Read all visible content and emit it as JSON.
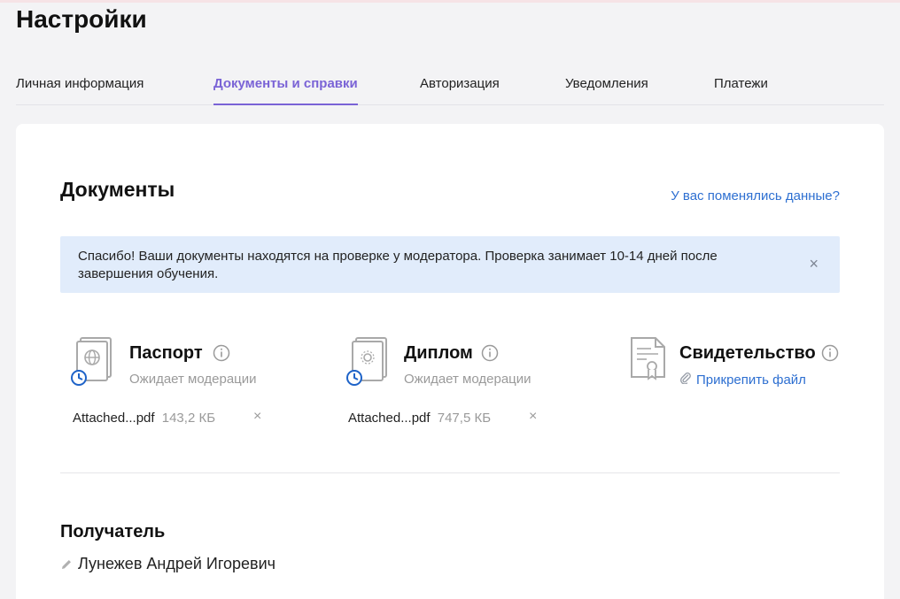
{
  "page": {
    "title": "Настройки"
  },
  "tabs": [
    {
      "label": "Личная информация",
      "active": false
    },
    {
      "label": "Документы и справки",
      "active": true
    },
    {
      "label": "Авторизация",
      "active": false
    },
    {
      "label": "Уведомления",
      "active": false
    },
    {
      "label": "Платежи",
      "active": false
    }
  ],
  "documents": {
    "title": "Документы",
    "data_changed_link": "У вас поменялись данные?",
    "notice": "Спасибо! Ваши документы находятся на проверке у модератора. Проверка занимает 10-14 дней после завершения обучения.",
    "notice_close": "×",
    "items": [
      {
        "title": "Паспорт",
        "status": "Ожидает модерации",
        "file_name": "Attached...pdf",
        "file_size": "143,2 КБ",
        "remove": "×",
        "icon": "passport-icon"
      },
      {
        "title": "Диплом",
        "status": "Ожидает модерации",
        "file_name": "Attached...pdf",
        "file_size": "747,5 КБ",
        "remove": "×",
        "icon": "diploma-icon"
      },
      {
        "title": "Свидетельство",
        "attach_link": "Прикрепить файл",
        "icon": "certificate-icon"
      }
    ]
  },
  "recipient": {
    "title": "Получатель",
    "name": "Лунежев Андрей Игоревич"
  },
  "colors": {
    "accent": "#7a63d6",
    "link": "#2d6fd1",
    "notice_bg": "#e1ecfb",
    "status_clock": "#1e63c8"
  }
}
